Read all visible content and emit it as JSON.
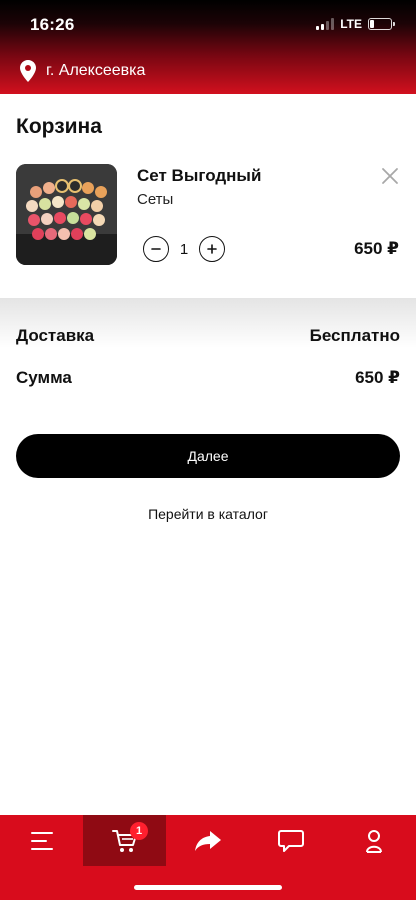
{
  "status_bar": {
    "time": "16:26",
    "network": "LTE",
    "signal_bars_active": 2,
    "signal_bars_total": 4,
    "battery_level": 0.2
  },
  "header": {
    "location": "г. Алексеевка",
    "location_icon": "map-pin-icon"
  },
  "cart": {
    "title": "Корзина",
    "items": [
      {
        "name": "Сет Выгодный",
        "category": "Сеты",
        "quantity": "1",
        "price": "650 ₽",
        "image": "sushi-set-photo",
        "remove_icon": "close-icon",
        "decrease_icon": "minus-circle-icon",
        "increase_icon": "plus-circle-icon"
      }
    ]
  },
  "summary": {
    "delivery_label": "Доставка",
    "delivery_value": "Бесплатно",
    "total_label": "Сумма",
    "total_value": "650 ₽"
  },
  "actions": {
    "next_label": "Далее",
    "catalog_link": "Перейти в каталог"
  },
  "bottom_nav": {
    "items": [
      {
        "icon": "menu-icon",
        "active": false
      },
      {
        "icon": "cart-icon",
        "active": true,
        "badge": "1"
      },
      {
        "icon": "share-arrow-icon",
        "active": false
      },
      {
        "icon": "chat-icon",
        "active": false
      },
      {
        "icon": "profile-icon",
        "active": false
      }
    ]
  },
  "colors": {
    "brand_red": "#d80c1c",
    "active_nav": "#8f0a13",
    "button_black": "#000000"
  }
}
